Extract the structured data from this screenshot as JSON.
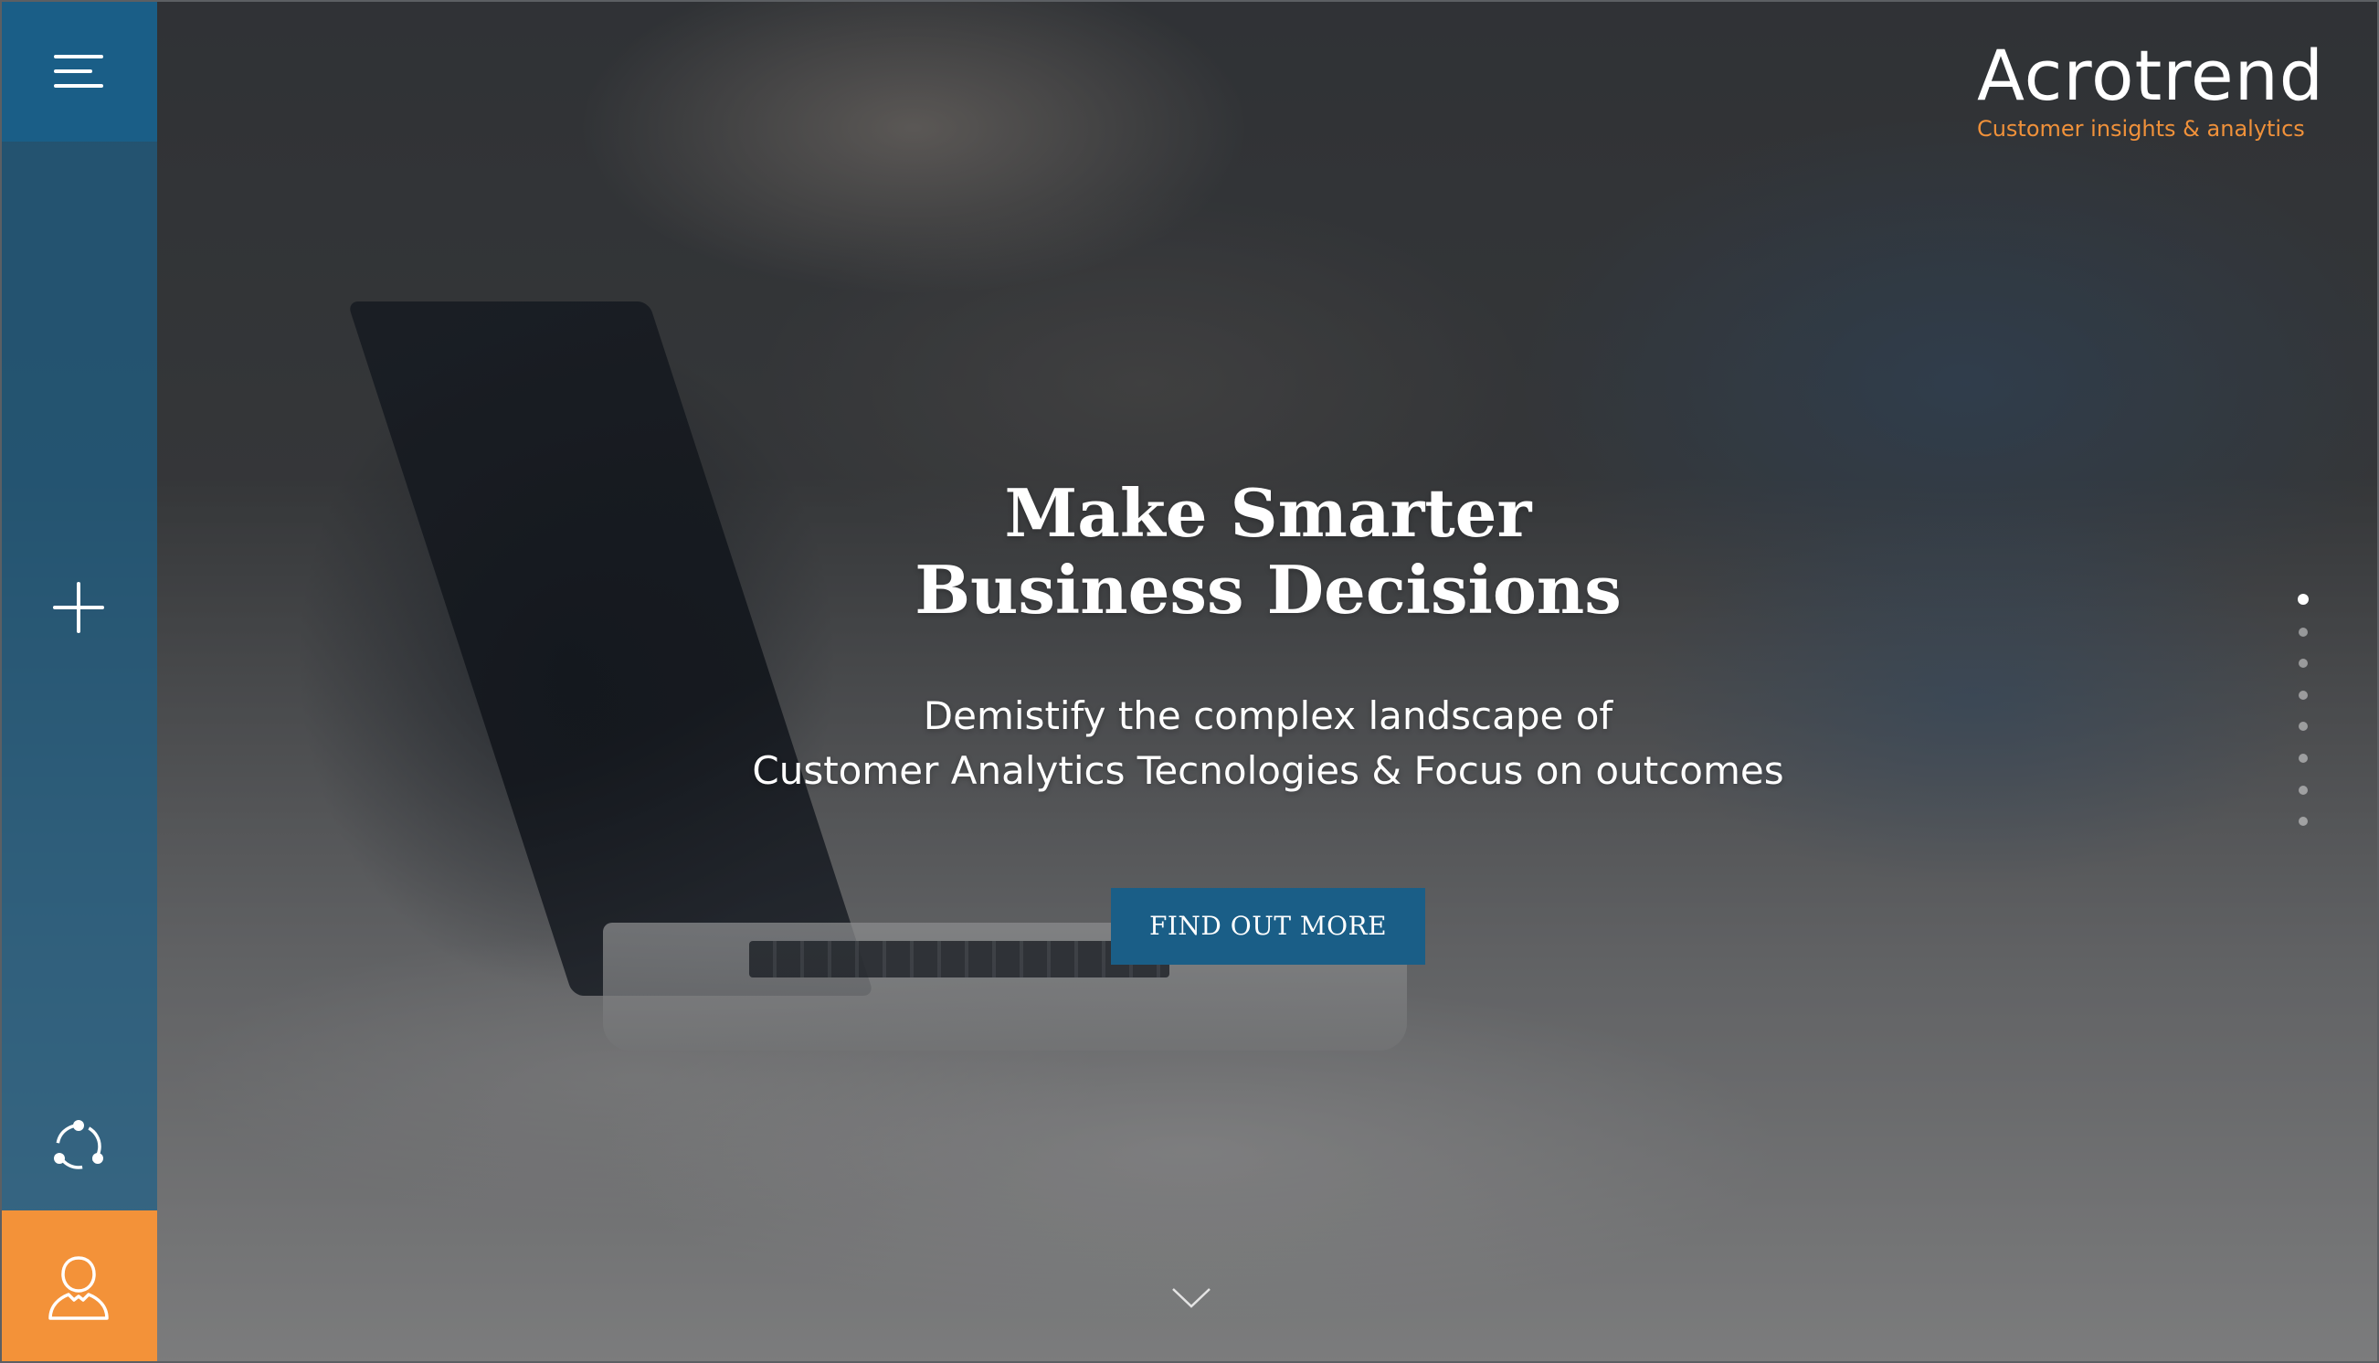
{
  "sidebar": {
    "menu_icon": "hamburger-menu-icon",
    "add_icon": "plus-icon",
    "share_icon": "network-share-icon",
    "user_icon": "user-icon"
  },
  "logo": {
    "name": "Acrotrend",
    "tagline": "Customer insights & analytics"
  },
  "hero": {
    "title_line1": "Make Smarter",
    "title_line2": "Business Decisions",
    "subtitle_line1": "Demistify the complex landscape of",
    "subtitle_line2": "Customer Analytics Tecnologies & Focus on outcomes",
    "cta_label": "FIND OUT MORE"
  },
  "pagination": {
    "total": 8,
    "active_index": 0
  },
  "scroll_icon": "chevron-down-icon",
  "colors": {
    "brand_blue": "#1a5e87",
    "brand_orange": "#f39239",
    "tagline_orange": "#f0913a",
    "text_white": "#ffffff"
  }
}
